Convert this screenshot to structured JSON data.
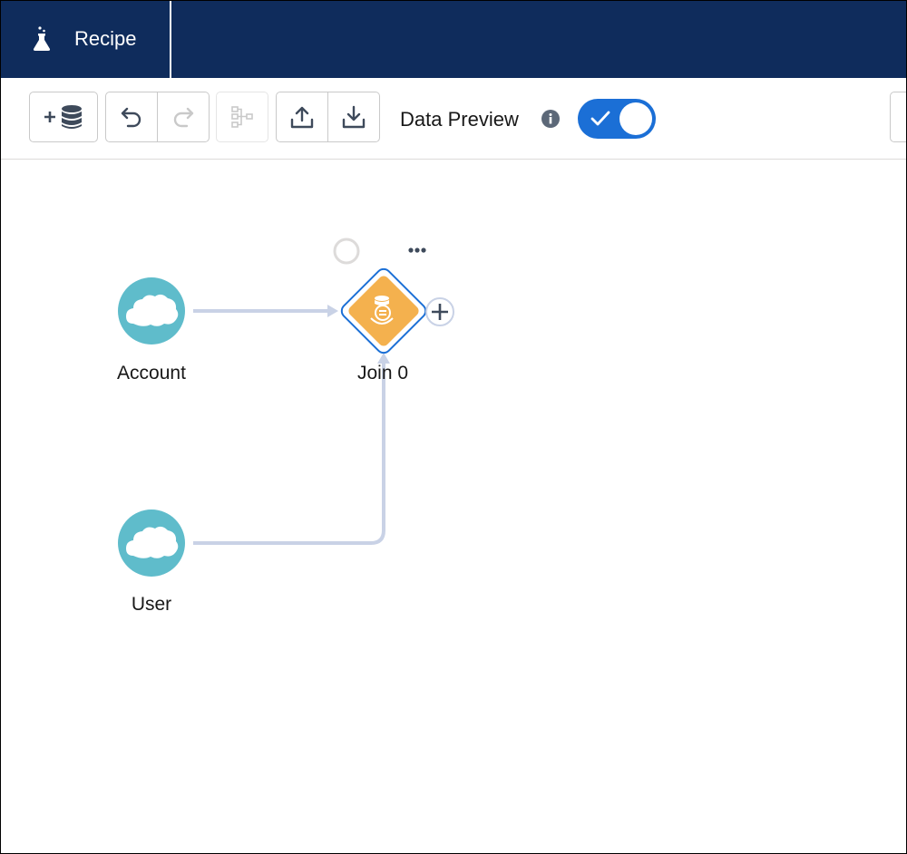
{
  "header": {
    "tab_label": "Recipe",
    "tab_icon": "flask-icon"
  },
  "toolbar": {
    "add_data_icon": "add-data-icon",
    "undo_icon": "undo-icon",
    "redo_icon": "redo-icon",
    "hierarchy_icon": "hierarchy-icon",
    "upload_icon": "upload-icon",
    "download_icon": "download-icon",
    "data_preview_label": "Data Preview",
    "data_preview_enabled": true
  },
  "canvas": {
    "nodes": [
      {
        "label": "Account",
        "type": "input",
        "icon": "salesforce-cloud-icon"
      },
      {
        "label": "Join 0",
        "type": "join",
        "icon": "join-icon"
      },
      {
        "label": "User",
        "type": "input",
        "icon": "salesforce-cloud-icon"
      }
    ],
    "colors": {
      "header_bg": "#0f2c5c",
      "input_node": "#5fbccb",
      "join_node": "#f4b14e",
      "toggle_on": "#1b6fd6",
      "connector": "#c9d2e6"
    }
  }
}
